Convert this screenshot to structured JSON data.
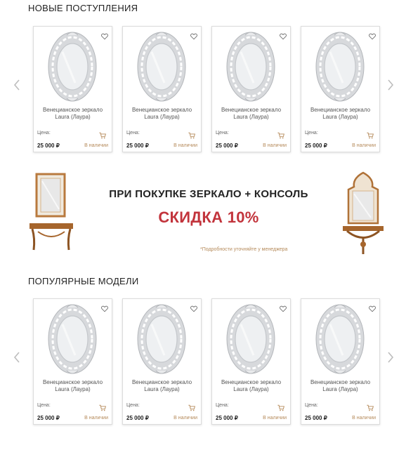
{
  "sections": {
    "new_title": "НОВЫЕ ПОСТУПЛЕНИЯ",
    "popular_title": "ПОПУЛЯРНЫЕ МОДЕЛИ"
  },
  "products_new": [
    {
      "name": "Венецианское зеркало Laura (Лаура)",
      "price_label": "Цена:",
      "price": "25 000 ₽",
      "stock": "В наличии"
    },
    {
      "name": "Венецианское зеркало Laura (Лаура)",
      "price_label": "Цена:",
      "price": "25 000 ₽",
      "stock": "В наличии"
    },
    {
      "name": "Венецианское зеркало Laura (Лаура)",
      "price_label": "Цена:",
      "price": "25 000 ₽",
      "stock": "В наличии"
    },
    {
      "name": "Венецианское зеркало Laura (Лаура)",
      "price_label": "Цена:",
      "price": "25 000 ₽",
      "stock": "В наличии"
    }
  ],
  "products_popular": [
    {
      "name": "Венецианское зеркало Laura (Лаура)",
      "price_label": "Цена:",
      "price": "25 000 ₽",
      "stock": "В наличии"
    },
    {
      "name": "Венецианское зеркало Laura (Лаура)",
      "price_label": "Цена:",
      "price": "25 000 ₽",
      "stock": "В наличии"
    },
    {
      "name": "Венецианское зеркало Laura (Лаура)",
      "price_label": "Цена:",
      "price": "25 000 ₽",
      "stock": "В наличии"
    },
    {
      "name": "Венецианское зеркало Laura (Лаура)",
      "price_label": "Цена:",
      "price": "25 000 ₽",
      "stock": "В наличии"
    }
  ],
  "promo": {
    "line1": "ПРИ ПОКУПКЕ ЗЕРКАЛО + КОНСОЛЬ",
    "line2": "СКИДКА 10%",
    "note": "*Подробности уточняйте у менеджера"
  },
  "colors": {
    "accent": "#c2343c",
    "gold": "#b58a5a",
    "border": "#dcdcdc"
  },
  "icons": [
    "heart-icon",
    "cart-icon",
    "chevron-left-icon",
    "chevron-right-icon",
    "mirror-icon"
  ]
}
